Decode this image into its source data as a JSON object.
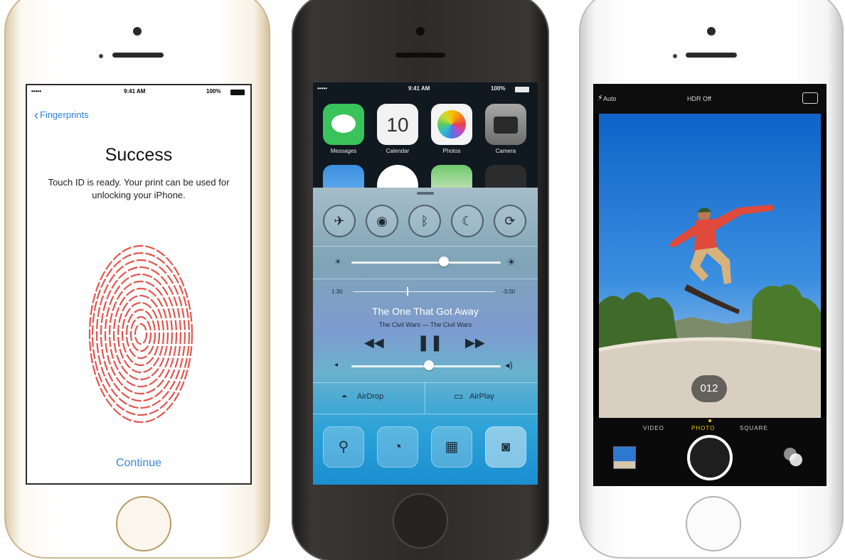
{
  "phone1": {
    "status": {
      "carrier": "••••• ",
      "time": "9:41 AM",
      "battery": "100%"
    },
    "nav": {
      "back_label": "Fingerprints"
    },
    "title": "Success",
    "message": "Touch ID is ready. Your print can be used for unlocking your iPhone.",
    "continue_label": "Continue"
  },
  "phone2": {
    "status": {
      "carrier": "••••• ",
      "time": "9:41 AM",
      "battery": "100%"
    },
    "apps": [
      {
        "label": "Messages",
        "color": "#39c35a"
      },
      {
        "label": "Calendar",
        "calendar_day": "10",
        "color": "#f2f2f2"
      },
      {
        "label": "Photos",
        "color": "#f4f4f4"
      },
      {
        "label": "Camera",
        "color": "#8a8a8a"
      }
    ],
    "control_center": {
      "brightness_level": 0.62,
      "music": {
        "elapsed": "1:30",
        "remaining": "-3:00",
        "progress": 0.38,
        "title": "The One That Got Away",
        "artist": "The Civil Wars — The Civil Wars",
        "volume_level": 0.52
      },
      "airdrop_label": "AirDrop",
      "airplay_label": "AirPlay"
    }
  },
  "phone3": {
    "flash_label": "Auto",
    "hdr_label": "HDR Off",
    "modes": [
      "VIDEO",
      "PHOTO",
      "SQUARE"
    ],
    "active_mode": "PHOTO",
    "burst_count": "012"
  },
  "colors": {
    "link_blue": "#2a7fe0",
    "fingerprint_red": "#e2554e",
    "camera_mode_yellow": "#f2c200"
  }
}
